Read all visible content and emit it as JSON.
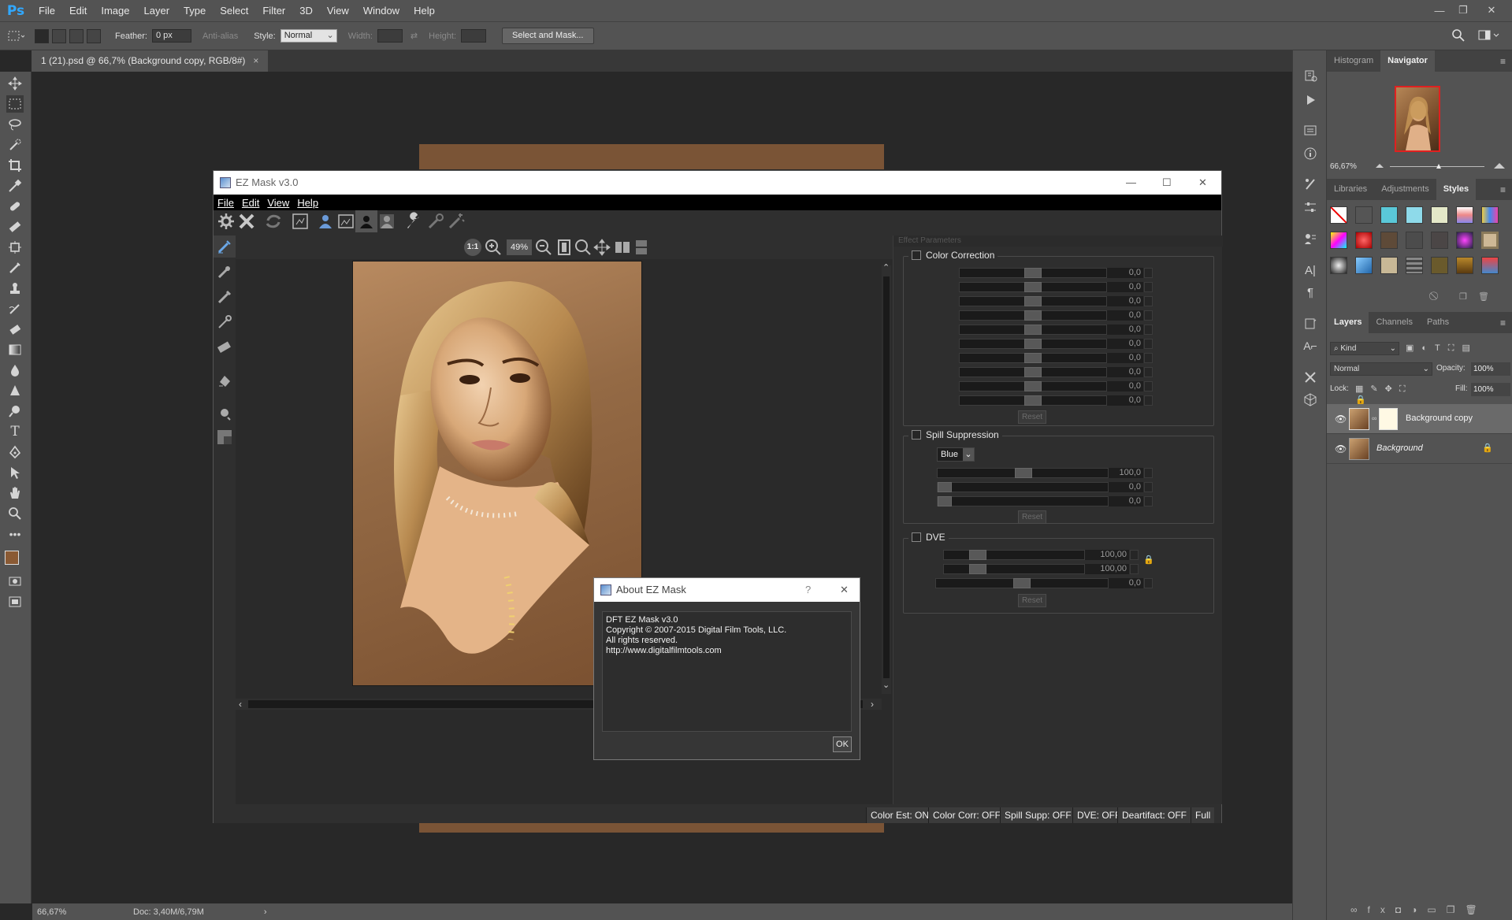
{
  "app": {
    "logo": "Ps",
    "menu": [
      "File",
      "Edit",
      "Image",
      "Layer",
      "Type",
      "Select",
      "Filter",
      "3D",
      "View",
      "Window",
      "Help"
    ]
  },
  "options": {
    "feather_label": "Feather:",
    "feather_value": "0 px",
    "antialias_label": "Anti-alias",
    "style_label": "Style:",
    "style_value": "Normal",
    "width_label": "Width:",
    "height_label": "Height:",
    "select_mask_label": "Select and Mask..."
  },
  "document": {
    "tab_title": "1 (21).psd @ 66,7% (Background copy, RGB/8#)",
    "close": "×"
  },
  "status": {
    "zoom": "66,67%",
    "doc": "Doc: 3,40M/6,79M",
    "arrow": "›"
  },
  "navigator": {
    "tabs": [
      "Histogram",
      "Navigator"
    ],
    "zoom": "66,67%"
  },
  "styles": {
    "tabs": [
      "Libraries",
      "Adjustments",
      "Styles"
    ]
  },
  "layers": {
    "tabs": [
      "Layers",
      "Channels",
      "Paths"
    ],
    "kind_label": "Kind",
    "blend_mode": "Normal",
    "opacity_label": "Opacity:",
    "opacity_value": "100%",
    "lock_label": "Lock:",
    "fill_label": "Fill:",
    "fill_value": "100%",
    "items": [
      {
        "name": "Background copy"
      },
      {
        "name": "Background"
      }
    ]
  },
  "ez": {
    "title": "EZ Mask v3.0",
    "menu": [
      "File",
      "Edit",
      "View",
      "Help"
    ],
    "zoom": "49%",
    "zoom_one": "1:1",
    "effect_panel_title": "Effect Parameters",
    "color_correction": {
      "title": "Color Correction",
      "values": [
        "0,0",
        "0,0",
        "0,0",
        "0,0",
        "0,0",
        "0,0",
        "0,0",
        "0,0",
        "0,0",
        "0,0"
      ],
      "reset": "Reset"
    },
    "spill": {
      "title": "Spill Suppression",
      "color": "Blue",
      "values": [
        "100,0",
        "0,0",
        "0,0"
      ],
      "reset": "Reset"
    },
    "dve": {
      "title": "DVE",
      "values": [
        "100,00",
        "100,00",
        "0,0"
      ],
      "reset": "Reset"
    },
    "statuses": [
      "Color Est: ON",
      "Color Corr: OFF",
      "Spill Supp: OFF",
      "DVE: OFF",
      "Deartifact: OFF",
      "Full"
    ]
  },
  "about": {
    "title": "About EZ Mask",
    "help": "?",
    "lines": [
      "DFT EZ Mask v3.0",
      "Copyright © 2007-2015 Digital Film Tools, LLC.",
      "All rights reserved.",
      "http://www.digitalfilmtools.com"
    ],
    "ok": "OK"
  }
}
